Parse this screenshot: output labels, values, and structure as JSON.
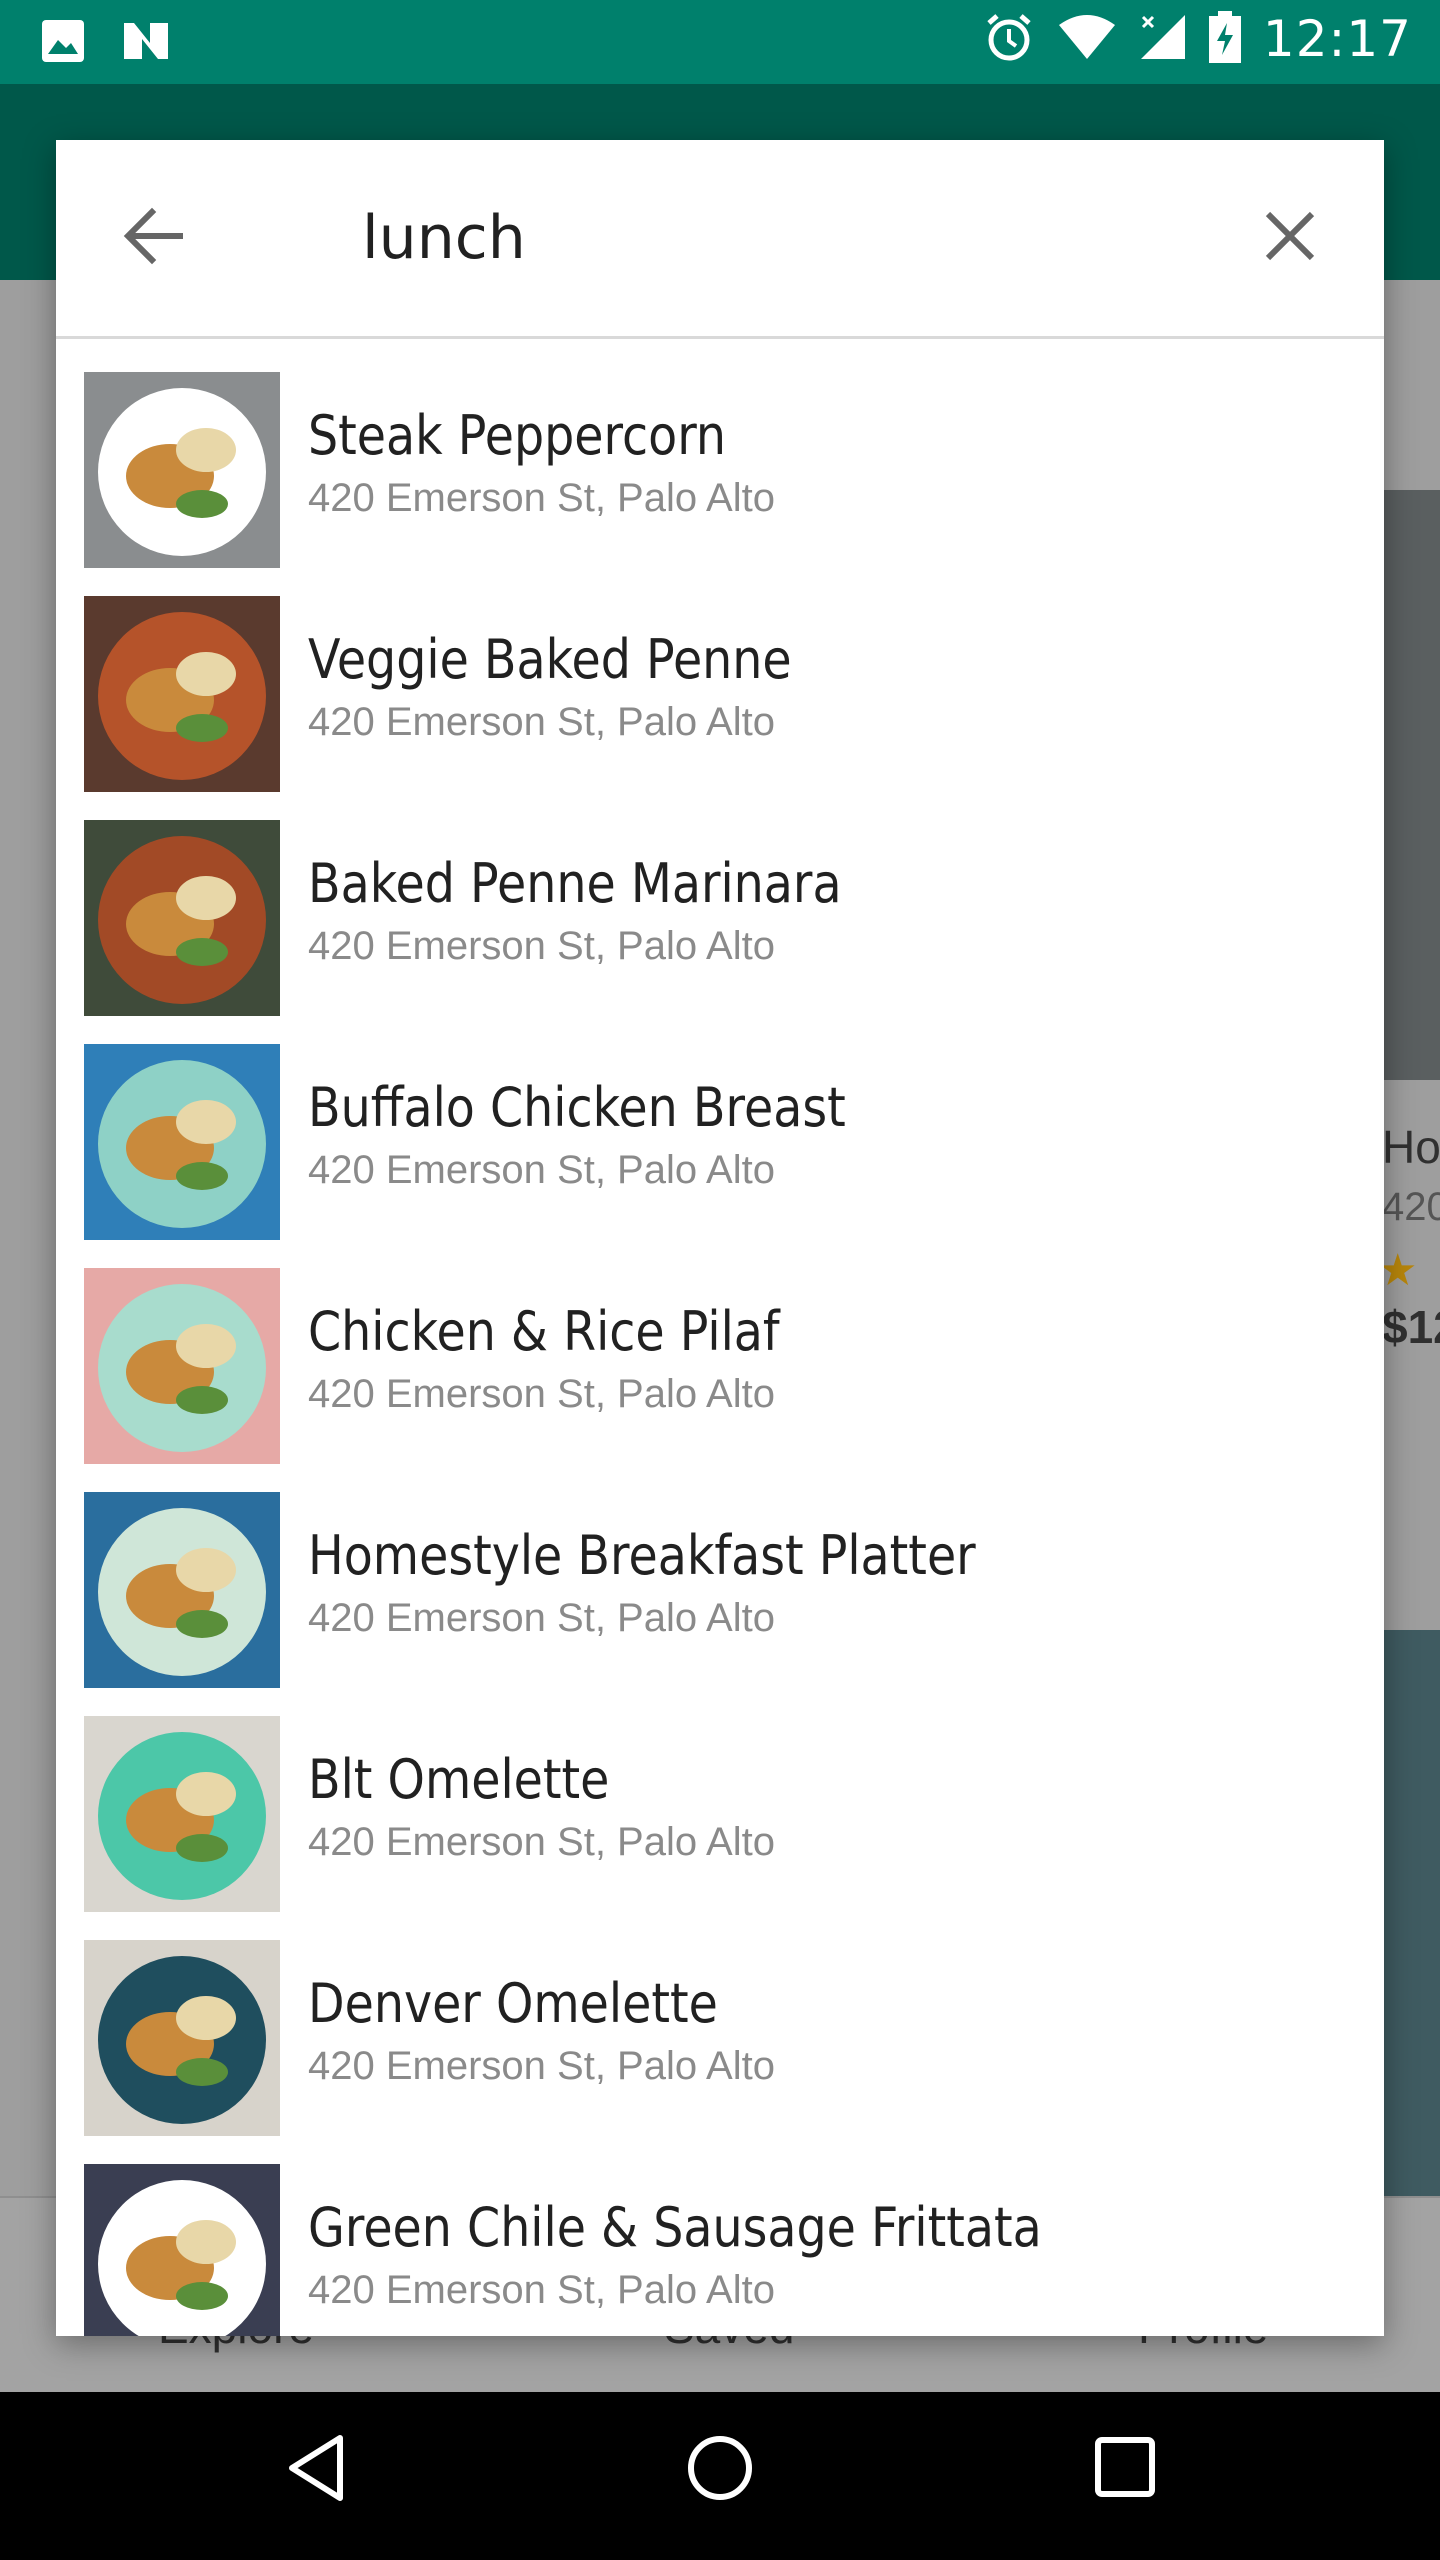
{
  "status_bar": {
    "time": "12:17",
    "icons": [
      "image-icon",
      "n-notification-icon",
      "alarm-icon",
      "wifi-icon",
      "signal-icon",
      "battery-charging-icon"
    ]
  },
  "background_page": {
    "partial_texts": [
      "Ho",
      "420",
      "$12"
    ],
    "bottom_nav": [
      "Explore",
      "Saved",
      "Profile"
    ]
  },
  "search": {
    "query": "lunch",
    "back_icon": "arrow-back-icon",
    "clear_icon": "close-icon"
  },
  "results": [
    {
      "title": "Steak Peppercorn",
      "address": "420 Emerson St, Palo Alto",
      "plate": "#ffffff",
      "table": "#8a8d8f"
    },
    {
      "title": "Veggie Baked Penne",
      "address": "420 Emerson St, Palo Alto",
      "plate": "#b5532a",
      "table": "#5a3a2e"
    },
    {
      "title": "Baked Penne Marinara",
      "address": "420 Emerson St, Palo Alto",
      "plate": "#a24a26",
      "table": "#3f4b3a"
    },
    {
      "title": "Buffalo Chicken Breast",
      "address": "420 Emerson St, Palo Alto",
      "plate": "#8ed1c6",
      "table": "#2f7fb8"
    },
    {
      "title": "Chicken & Rice Pilaf",
      "address": "420 Emerson St, Palo Alto",
      "plate": "#a8dccd",
      "table": "#e6a9a6"
    },
    {
      "title": "Homestyle Breakfast Platter",
      "address": "420 Emerson St, Palo Alto",
      "plate": "#cfe6d8",
      "table": "#2a6e9e"
    },
    {
      "title": "Blt Omelette",
      "address": "420 Emerson St, Palo Alto",
      "plate": "#4cc7a8",
      "table": "#d9d6cf"
    },
    {
      "title": "Denver Omelette",
      "address": "420 Emerson St, Palo Alto",
      "plate": "#1f4e5e",
      "table": "#d7d3cb"
    },
    {
      "title": "Green Chile & Sausage Frittata",
      "address": "420 Emerson St, Palo Alto",
      "plate": "#ffffff",
      "table": "#3a3e52"
    }
  ],
  "system_nav": [
    "back-triangle-icon",
    "home-circle-icon",
    "recents-square-icon"
  ],
  "colors": {
    "status_bar": "#00806c",
    "toolbar": "#00584a",
    "title_text": "#212121",
    "subtitle_text": "#8a8a8a"
  }
}
